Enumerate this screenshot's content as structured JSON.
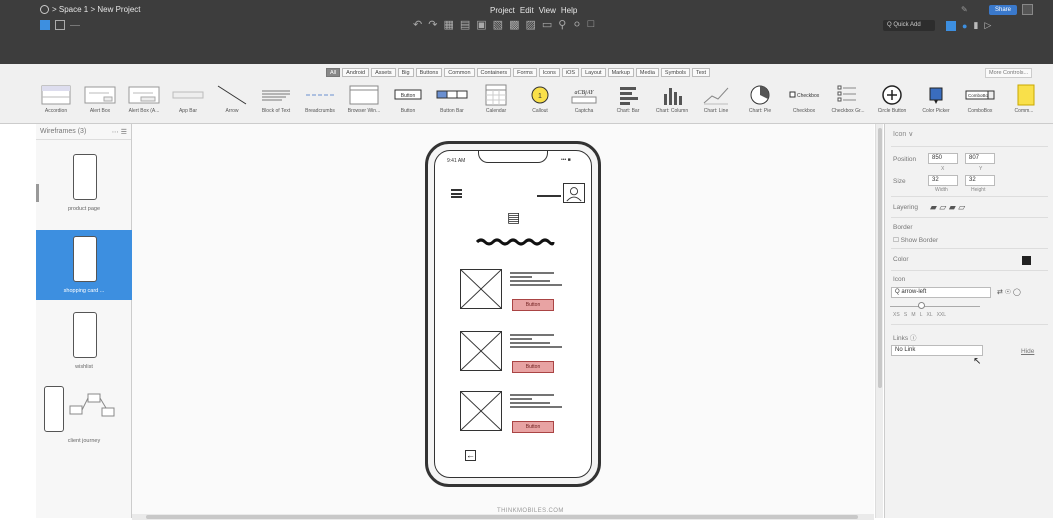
{
  "topbar": {
    "breadcrumb": "> Space 1 > New Project",
    "menu": [
      "Project",
      "Edit",
      "View",
      "Help"
    ],
    "quick_add": "Q Quick Add",
    "share": "Share"
  },
  "library": {
    "tabs": [
      "All",
      "Android",
      "Assets",
      "Big",
      "Buttons",
      "Common",
      "Containers",
      "Forms",
      "Icons",
      "iOS",
      "Layout",
      "Markup",
      "Media",
      "Symbols",
      "Text"
    ],
    "active_tab": "All",
    "more_controls": "More Controls...",
    "items": [
      {
        "label": "Accordion",
        "icon": "accordion-thumb"
      },
      {
        "label": "Alert Box",
        "icon": "alert-box-thumb"
      },
      {
        "label": "Alert Box (A...",
        "icon": "alert-box-alt-thumb"
      },
      {
        "label": "App Bar",
        "icon": "app-bar-thumb"
      },
      {
        "label": "Arrow",
        "icon": "arrow-thumb"
      },
      {
        "label": "Block of Text",
        "icon": "block-of-text-thumb"
      },
      {
        "label": "Breadcrumbs",
        "icon": "breadcrumbs-thumb"
      },
      {
        "label": "Browser Win...",
        "icon": "browser-window-thumb"
      },
      {
        "label": "Button",
        "icon": "button-thumb"
      },
      {
        "label": "Button Bar",
        "icon": "button-bar-thumb"
      },
      {
        "label": "Calendar",
        "icon": "calendar-thumb"
      },
      {
        "label": "Callout",
        "icon": "callout-thumb"
      },
      {
        "label": "Captcha",
        "icon": "captcha-thumb"
      },
      {
        "label": "Chart: Bar",
        "icon": "chart-bar-thumb"
      },
      {
        "label": "Chart: Column",
        "icon": "chart-column-thumb"
      },
      {
        "label": "Chart: Line",
        "icon": "chart-line-thumb"
      },
      {
        "label": "Chart: Pie",
        "icon": "chart-pie-thumb"
      },
      {
        "label": "Checkbox",
        "icon": "checkbox-thumb"
      },
      {
        "label": "Checkbox Gr...",
        "icon": "checkbox-group-thumb"
      },
      {
        "label": "Circle Button",
        "icon": "circle-button-thumb"
      },
      {
        "label": "Color Picker",
        "icon": "color-picker-thumb"
      },
      {
        "label": "ComboBox",
        "icon": "combobox-thumb"
      },
      {
        "label": "Comm...",
        "icon": "comment-thumb"
      }
    ],
    "checkbox_text": "Checkbox",
    "captcha_text": "aCBjAY",
    "button_text": "Button",
    "combobox_text": "ComboBox"
  },
  "left_panel": {
    "title": "Wireframes (3)",
    "pages": [
      {
        "label": "product page",
        "selected": false
      },
      {
        "label": "shopping card ...",
        "selected": true
      },
      {
        "label": "wishlist",
        "selected": false
      },
      {
        "label": "client journey",
        "selected": false
      }
    ]
  },
  "phone": {
    "time": "9:41 AM",
    "signal": "••• ■",
    "button_label": "Button",
    "products": 3
  },
  "properties": {
    "title": "Icon",
    "position_label": "Position",
    "x_value": "850",
    "y_value": "807",
    "x_sub": "X",
    "y_sub": "Y",
    "size_label": "Size",
    "width_value": "32",
    "height_value": "32",
    "width_sub": "Width",
    "height_sub": "Height",
    "layering_label": "Layering",
    "border_label": "Border",
    "show_border": "Show Border",
    "color_label": "Color",
    "icon_label": "Icon",
    "icon_value": "Q arrow-left",
    "size_options": [
      "XS",
      "S",
      "M",
      "L",
      "XL",
      "XXL"
    ],
    "links_label": "Links",
    "links_value": "No Link",
    "hide_label": "Hide",
    "color_value": "#222222"
  },
  "footer": "THINKMOBILES.COM"
}
